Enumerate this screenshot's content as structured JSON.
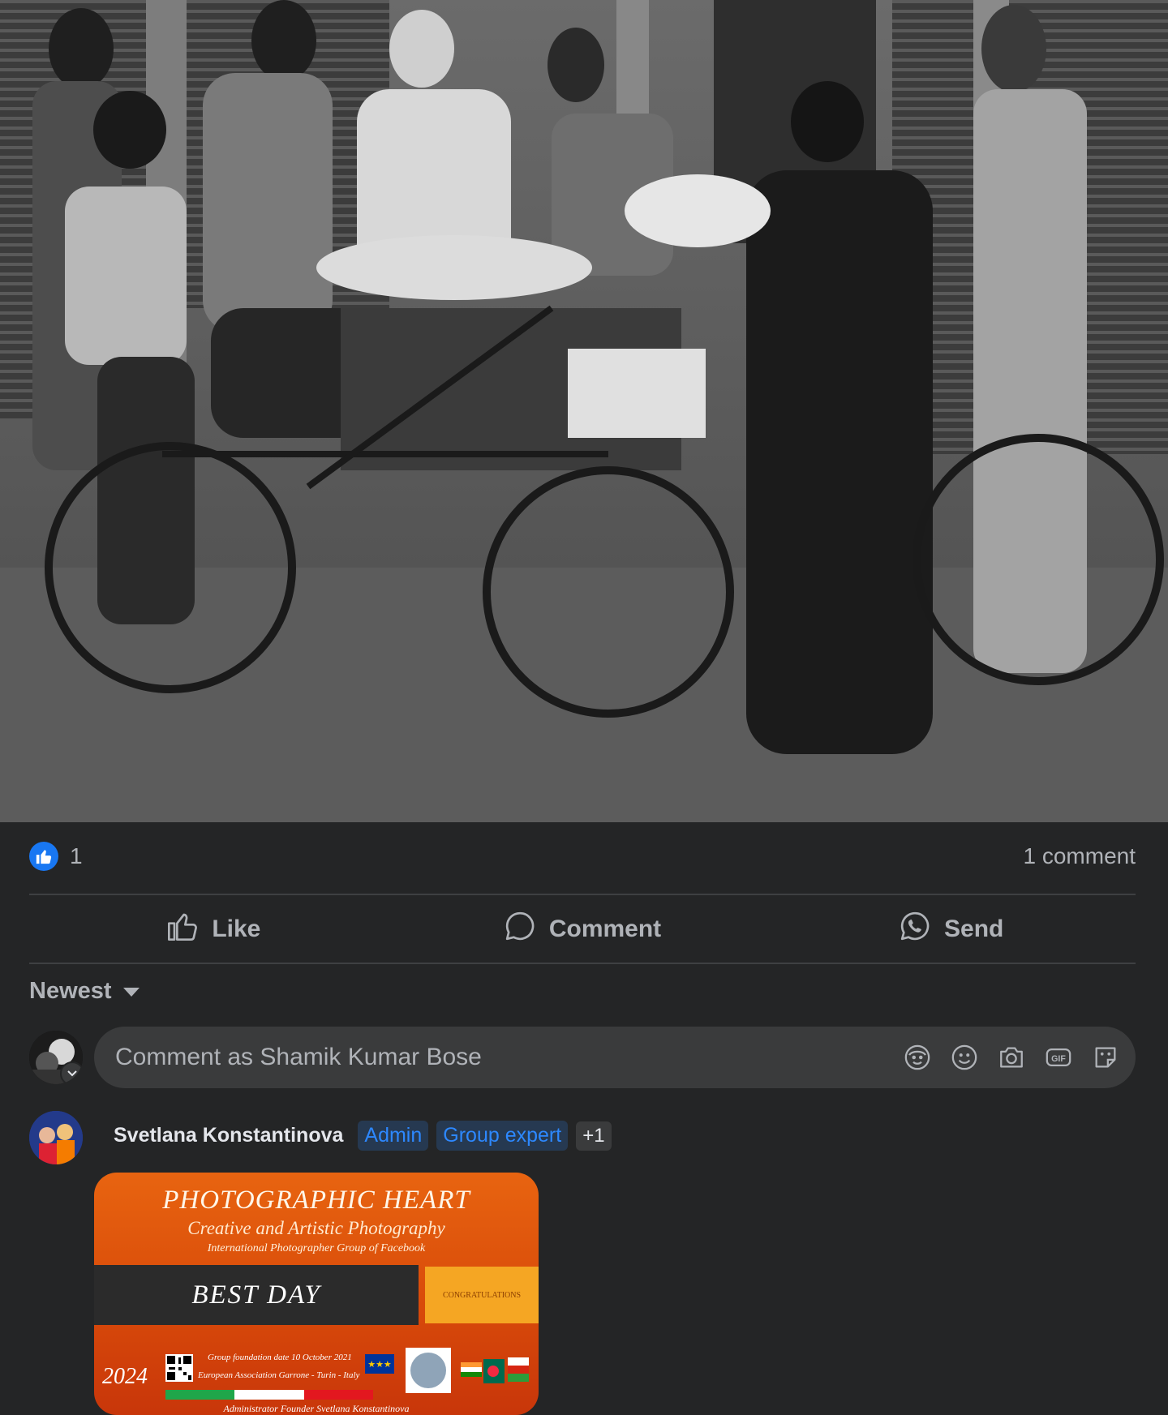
{
  "post": {
    "photo_alt": "Black and white street photo: people gathered around a banana vendor's bicycle cart in front of shuttered shops",
    "reactions": {
      "icon": "thumbs-up-icon",
      "count": "1"
    },
    "comment_count": "1 comment"
  },
  "actions": {
    "like_label": "Like",
    "comment_label": "Comment",
    "send_label": "Send"
  },
  "sort": {
    "label": "Newest"
  },
  "composer": {
    "placeholder": "Comment as Shamik Kumar Bose",
    "tools": [
      "avatar-sticker-icon",
      "emoji-icon",
      "camera-icon",
      "gif-icon",
      "sticker-icon"
    ]
  },
  "comment": {
    "author": "Svetlana Konstantinova",
    "badges": [
      "Admin",
      "Group expert"
    ],
    "badge_more": "+1",
    "card": {
      "title": "PHOTOGRAPHIC HEART",
      "subtitle": "Creative and Artistic Photography",
      "subtitle2": "International Photographer Group of Facebook",
      "band": "BEST DAY",
      "congrats": "CONGRATULATIONS",
      "year": "2024",
      "info1": "Group foundation date 10 October 2021",
      "info2": "European Association Garrone - Turin - Italy",
      "bottom": "Administrator Founder Svetlana Konstantinova"
    }
  },
  "colors": {
    "background": "#242526",
    "accent": "#1877f2",
    "badge_text": "#2d88ff",
    "secondary_text": "#b0b3b8"
  }
}
